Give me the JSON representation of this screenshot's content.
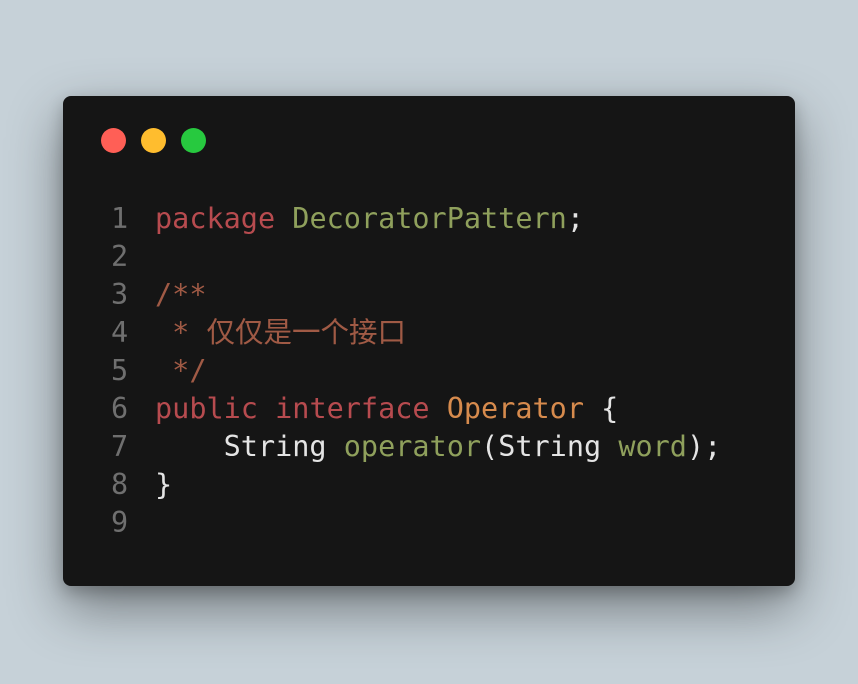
{
  "window": {
    "controls": [
      {
        "name": "close",
        "color": "#ff5f56"
      },
      {
        "name": "minimize",
        "color": "#ffbd2e"
      },
      {
        "name": "maximize",
        "color": "#27c93f"
      }
    ]
  },
  "code": {
    "colors": {
      "keyword": "#b74b4f",
      "type": "#d78b4d",
      "function": "#8fa05c",
      "comment": "#a05a45",
      "plain": "#e4e4e4",
      "line_number": "#6f6f6f",
      "background": "#151515"
    },
    "lines": [
      {
        "number": "1",
        "tokens": [
          {
            "text": "package",
            "kind": "kw"
          },
          {
            "text": " ",
            "kind": "pl"
          },
          {
            "text": "DecoratorPattern",
            "kind": "fn"
          },
          {
            "text": ";",
            "kind": "pl"
          }
        ]
      },
      {
        "number": "2",
        "tokens": []
      },
      {
        "number": "3",
        "tokens": [
          {
            "text": "/**",
            "kind": "cm"
          }
        ]
      },
      {
        "number": "4",
        "tokens": [
          {
            "text": " * 仅仅是一个接口",
            "kind": "cm"
          }
        ]
      },
      {
        "number": "5",
        "tokens": [
          {
            "text": " */",
            "kind": "cm"
          }
        ]
      },
      {
        "number": "6",
        "tokens": [
          {
            "text": "public",
            "kind": "kw"
          },
          {
            "text": " ",
            "kind": "pl"
          },
          {
            "text": "interface",
            "kind": "kw"
          },
          {
            "text": " ",
            "kind": "pl"
          },
          {
            "text": "Operator",
            "kind": "ty"
          },
          {
            "text": " {",
            "kind": "pl"
          }
        ]
      },
      {
        "number": "7",
        "tokens": [
          {
            "text": "    String ",
            "kind": "pl"
          },
          {
            "text": "operator",
            "kind": "fn"
          },
          {
            "text": "(String ",
            "kind": "pl"
          },
          {
            "text": "word",
            "kind": "fn"
          },
          {
            "text": ");",
            "kind": "pl"
          }
        ]
      },
      {
        "number": "8",
        "tokens": [
          {
            "text": "}",
            "kind": "pl"
          }
        ]
      },
      {
        "number": "9",
        "tokens": []
      }
    ]
  }
}
